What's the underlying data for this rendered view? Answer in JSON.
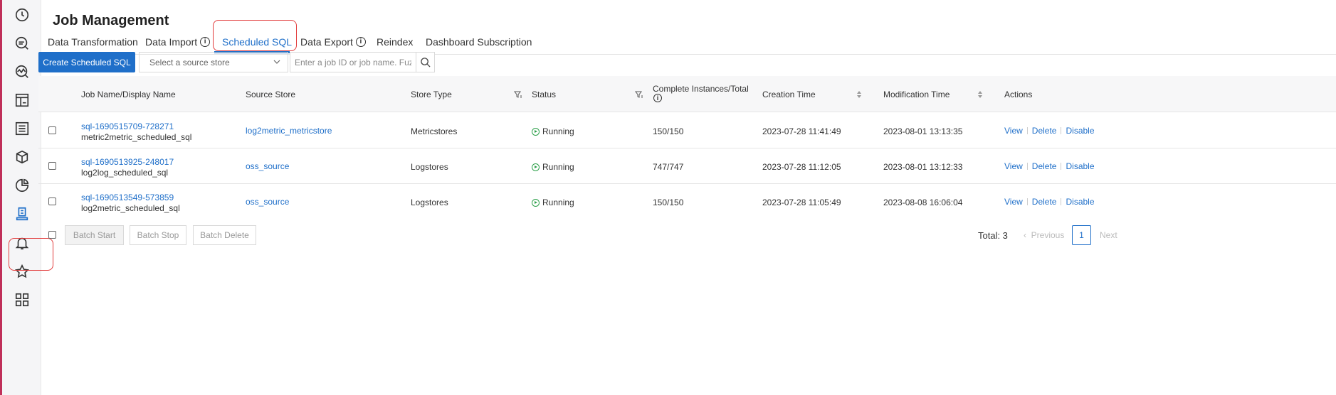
{
  "sidebar": {
    "icons": [
      "clock-icon",
      "search-list-icon",
      "monitor-icon",
      "dashboard-icon",
      "list-icon",
      "package-icon",
      "pie-chart-icon",
      "job-icon",
      "bell-icon",
      "star-icon",
      "grid-icon"
    ]
  },
  "page": {
    "title": "Job Management"
  },
  "tabs": [
    {
      "label": "Data Transformation"
    },
    {
      "label": "Data Import"
    },
    {
      "label": "Scheduled SQL"
    },
    {
      "label": "Data Export"
    },
    {
      "label": "Reindex"
    },
    {
      "label": "Dashboard Subscription"
    }
  ],
  "toolbar": {
    "create_label": "Create Scheduled SQL",
    "source_placeholder": "Select a source store",
    "search_placeholder": "Enter a job ID or job name. Fuzzy m"
  },
  "table": {
    "headers": {
      "name": "Job Name/Display Name",
      "source": "Source Store",
      "store_type": "Store Type",
      "status": "Status",
      "instances": "Complete Instances/Total",
      "created": "Creation Time",
      "modified": "Modification Time",
      "actions": "Actions"
    },
    "rows": [
      {
        "job_id": "sql-1690515709-728271",
        "display": "metric2metric_scheduled_sql",
        "source": "log2metric_metricstore",
        "store_type": "Metricstores",
        "status": "Running",
        "instances": "150/150",
        "created": "2023-07-28 11:41:49",
        "modified": "2023-08-01 13:13:35"
      },
      {
        "job_id": "sql-1690513925-248017",
        "display": "log2log_scheduled_sql",
        "source": "oss_source",
        "store_type": "Logstores",
        "status": "Running",
        "instances": "747/747",
        "created": "2023-07-28 11:12:05",
        "modified": "2023-08-01 13:12:33"
      },
      {
        "job_id": "sql-1690513549-573859",
        "display": "log2metric_scheduled_sql",
        "source": "oss_source",
        "store_type": "Logstores",
        "status": "Running",
        "instances": "150/150",
        "created": "2023-07-28 11:05:49",
        "modified": "2023-08-08 16:06:04"
      }
    ],
    "actions": {
      "view": "View",
      "delete": "Delete",
      "disable": "Disable"
    }
  },
  "footer": {
    "batch_start": "Batch Start",
    "batch_stop": "Batch Stop",
    "batch_delete": "Batch Delete",
    "total": "Total: 3",
    "previous": "Previous",
    "page": "1",
    "next": "Next"
  },
  "colors": {
    "accent": "#1f6fc9",
    "running": "#2ea04b",
    "highlight": "#e23b3b"
  }
}
